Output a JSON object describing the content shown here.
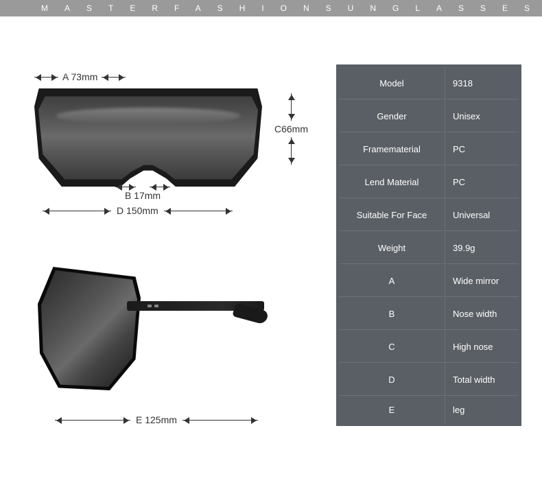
{
  "banner": "MASTERFASHIONSUNGLASSES",
  "dimensions": {
    "a": "A 73mm",
    "b": "B 17mm",
    "c": "C66mm",
    "d": "D 150mm",
    "e": "E 125mm"
  },
  "specs": [
    {
      "label": "Model",
      "value": "9318"
    },
    {
      "label": "Gender",
      "value": "Unisex"
    },
    {
      "label": "Framematerial",
      "value": "PC"
    },
    {
      "label": "Lend Material",
      "value": "PC"
    },
    {
      "label": "Suitable For Face",
      "value": "Universal"
    },
    {
      "label": "Weight",
      "value": "39.9g"
    },
    {
      "label": "A",
      "value": "Wide mirror"
    },
    {
      "label": "B",
      "value": "Nose width"
    },
    {
      "label": "C",
      "value": "High nose"
    },
    {
      "label": "D",
      "value": "Total width"
    },
    {
      "label": "E",
      "value": "leg"
    }
  ]
}
